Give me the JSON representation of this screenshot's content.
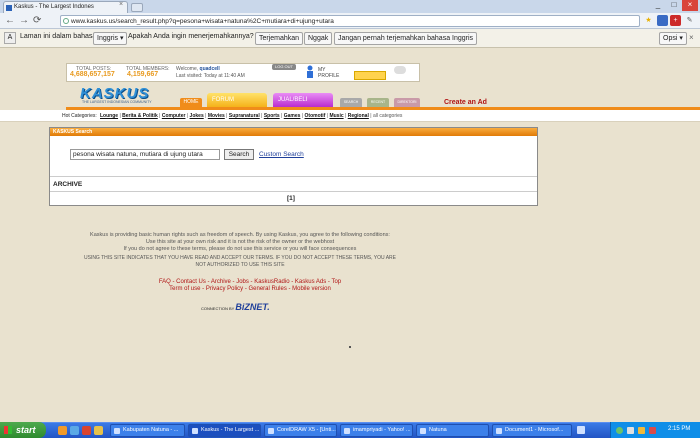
{
  "browser": {
    "tab_title": "Kaskus - The Largest Indones",
    "url": "www.kaskus.us/search_result.php?q=pesona+wisata+natuna%2C+mutiara+di+ujung+utara",
    "minimize": "_",
    "maximize": "□",
    "close": "×",
    "tab_close": "×"
  },
  "translate_bar": {
    "lead": "Laman ini dalam bahasa",
    "language": "Inggris",
    "question": "Apakah Anda ingin menerjemahkannya?",
    "translate_btn": "Terjemahkan",
    "nope_btn": "Nggak",
    "never_btn": "Jangan pernah terjemahkan bahasa Inggris",
    "options_btn": "Opsi"
  },
  "header": {
    "total_posts_label": "TOTAL POSTS:",
    "total_posts": "4,688,657,157",
    "total_members_label": "TOTAL MEMBERS:",
    "total_members": "4,159,667",
    "welcome_prefix": "Welcome,",
    "username": "quadcell",
    "last_visited": "Last visited: Today at 11:40 AM",
    "logout": "LOG OUT",
    "my_profile_1": "MY",
    "my_profile_2": "PROFILE",
    "logo": "KASKUS",
    "logo_sub": "THE LARGEST INDONESIAN COMMUNITY",
    "nav_home": "HOME",
    "nav_forum": "FORUM",
    "nav_jualbeli": "JUAL/BELI",
    "nav_small1": "SEARCH",
    "nav_small2": "RECENT",
    "nav_small3": "DIREKTORI",
    "create_ad": "Create an Ad"
  },
  "categories": {
    "label": "Hot Categories:",
    "items": [
      "Lounge",
      "Berita & Politik",
      "Computer",
      "Jokes",
      "Movies",
      "Supranatural",
      "Sports",
      "Games",
      "Otomotif",
      "Music",
      "Regional"
    ],
    "all": "all categories"
  },
  "search": {
    "heading": "KASKUS Search",
    "query": "pesona wisata natuna, mutiara di ujung utara",
    "button": "Search",
    "custom": "Custom Search",
    "archive": "ARCHIVE",
    "page": "[1]"
  },
  "footer": {
    "p1_l1": "Kaskus is providing basic human rights such as freedom of speech. By using Kaskus, you agree to the following conditions:",
    "p1_l2": "Use this site at your own risk and it is not the risk of the owner or the webhost",
    "p1_l3": "If you do not agree to these terms, please do not use this service or you will face consequences",
    "p2_l1": "USING THIS SITE INDICATES THAT YOU HAVE READ AND ACCEPT OUR TERMS. IF YOU DO NOT ACCEPT THESE TERMS, YOU ARE",
    "p2_l2": "NOT AUTHORIZED TO USE THIS SITE",
    "links_l1": "FAQ - Contact Us - Archive - Jobs - KaskusRadio - Kaskus Ads - Top",
    "links_l2": "Term of use - Privacy Policy - General Rules - Mobile version",
    "connection_label": "CONNECTION BY",
    "connection_brand": "BiZNET."
  },
  "taskbar": {
    "start": "start",
    "tasks": [
      "Kabupaten Natuna - ...",
      "Kaskus - The Largest ...",
      "CorelDRAW X5 - [Unti...",
      "imampriyadi - Yahoo! ...",
      "Natuna",
      "Document1 - Microsof..."
    ],
    "clock": "2:15 PM"
  },
  "colors": {
    "accent_orange": "#f08c1a",
    "forum_yellow": "#f5b21a",
    "jualbeli_purple": "#b92ccf",
    "taskbar_blue": "#2254c4"
  }
}
